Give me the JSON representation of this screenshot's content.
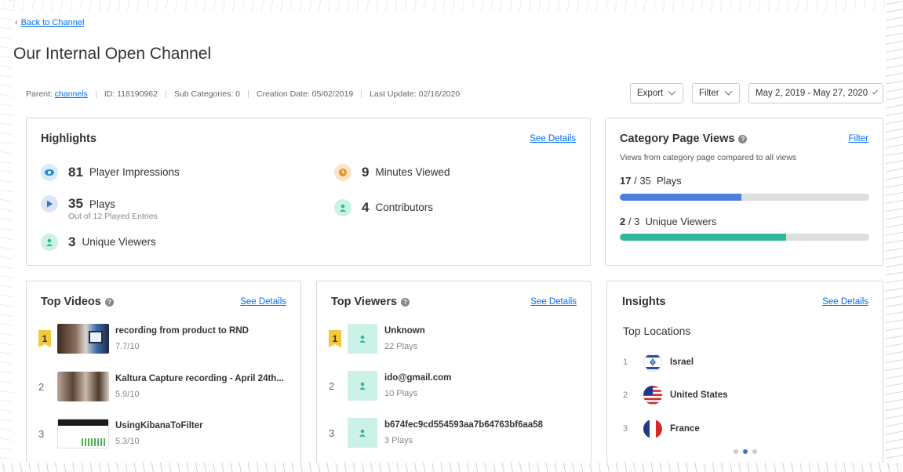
{
  "nav": {
    "back_label": "Back to Channel"
  },
  "page": {
    "title": "Our Internal Open Channel"
  },
  "meta": {
    "parent_label": "Parent:",
    "parent_link": "channels",
    "id_text": "ID: 118190962",
    "subcats_text": "Sub Categories: 0",
    "creation_text": "Creation Date: 05/02/2019",
    "update_text": "Last Update: 02/16/2020"
  },
  "controls": {
    "export_label": "Export",
    "filter_label": "Filter",
    "date_range": "May 2, 2019 - May 27, 2020"
  },
  "highlights": {
    "title": "Highlights",
    "see_details": "See Details",
    "impressions": {
      "num": "81",
      "label": "Player Impressions"
    },
    "plays": {
      "num": "35",
      "label": "Plays",
      "sub": "Out of 12 Played Entries"
    },
    "unique_viewers": {
      "num": "3",
      "label": "Unique Viewers"
    },
    "minutes": {
      "num": "9",
      "label": "Minutes Viewed"
    },
    "contributors": {
      "num": "4",
      "label": "Contributors"
    }
  },
  "category_views": {
    "title": "Category Page Views",
    "filter_label": "Filter",
    "subtitle": "Views from category page compared to all views",
    "plays": {
      "value": "17",
      "total": "35",
      "label": "Plays",
      "fraction": 0.486
    },
    "viewers": {
      "value": "2",
      "total": "3",
      "label": "Unique Viewers",
      "fraction": 0.667
    },
    "colors": {
      "plays": "#4a7fd8",
      "viewers": "#2fb89a"
    }
  },
  "top_videos": {
    "title": "Top Videos",
    "see_details": "See Details",
    "items": [
      {
        "rank": "1",
        "title": "recording from product to RND",
        "score": "7.7/10"
      },
      {
        "rank": "2",
        "title": "Kaltura Capture recording - April 24th...",
        "score": "5.9/10"
      },
      {
        "rank": "3",
        "title": "UsingKibanaToFilter",
        "score": "5.3/10"
      }
    ]
  },
  "top_viewers": {
    "title": "Top Viewers",
    "see_details": "See Details",
    "items": [
      {
        "rank": "1",
        "name": "Unknown",
        "plays": "22 Plays"
      },
      {
        "rank": "2",
        "name": "ido@gmail.com",
        "plays": "10 Plays"
      },
      {
        "rank": "3",
        "name": "b674fec9cd554593aa7b64763bf6aa58",
        "plays": "3 Plays"
      }
    ]
  },
  "insights": {
    "title": "Insights",
    "see_details": "See Details",
    "subtitle": "Top Locations",
    "locations": [
      {
        "rank": "1",
        "name": "Israel",
        "flag": "israel-flag-icon"
      },
      {
        "rank": "2",
        "name": "United States",
        "flag": "us-flag-icon"
      },
      {
        "rank": "3",
        "name": "France",
        "flag": "france-flag-icon"
      }
    ],
    "active_page": 2
  }
}
